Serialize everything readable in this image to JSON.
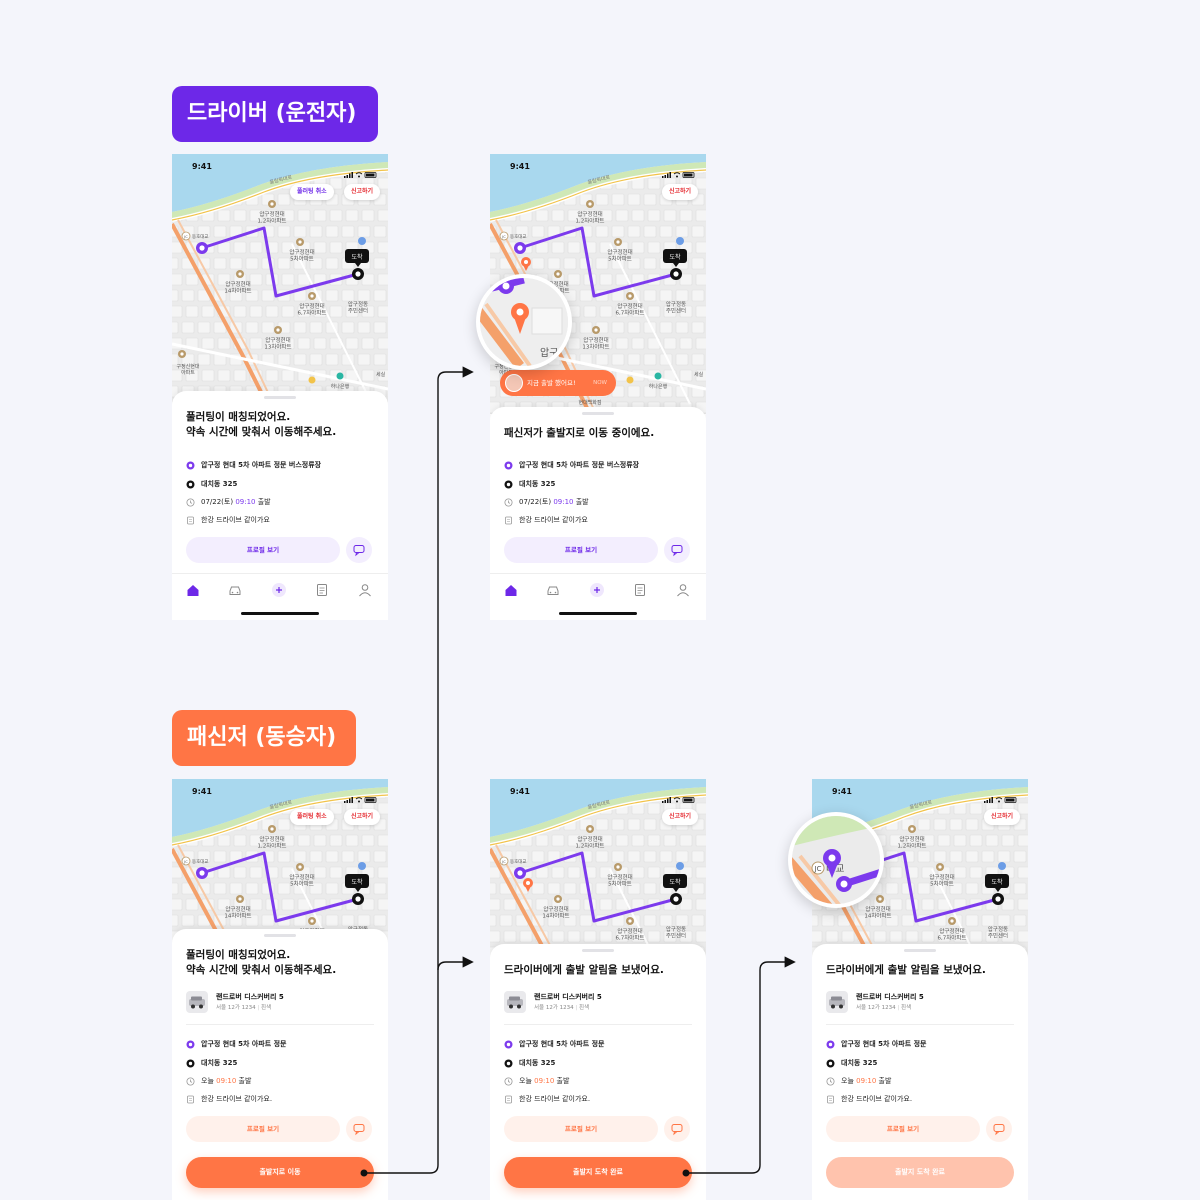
{
  "driver_tag": "드라이버 (운전자)",
  "passenger_tag": "패신저 (동승자)",
  "status_time": "9:41",
  "map": {
    "road_label": "올림픽대로",
    "bridge_label": "동호대교",
    "jc_label": "JC",
    "place_1": "압구정현대\n1,2차아파트",
    "place_2": "압구정현대\n5차아파트",
    "place_3": "압구정현대\n14차아파트",
    "place_4": "압구정현대\n6,7차아파트",
    "place_5": "압구정현대\n13차아파트",
    "place_6": "압구정동\n주민센터",
    "place_7": "하나은행",
    "place_8": "구정신현대\n아파트",
    "place_9": "세실",
    "place_10": "현대백화점",
    "arrive_badge": "도착",
    "zoom_label_1": "압구",
    "zoom_label_2": "대교"
  },
  "chips": {
    "cancel": "풀러팅 취소",
    "report": "신고하기"
  },
  "colors": {
    "driver_accent": "#6d28e8",
    "passenger_accent": "#ff7545",
    "report_red": "#e5292f",
    "route_purple": "#7c3aed"
  },
  "screens": {
    "d1": {
      "title": "풀러팅이 매칭되었어요.\n약속 시간에 맞춰서 이동해주세요.",
      "origin": "압구정 현대 5차 아파트 정문 버스정류장",
      "destination": "대치동 325",
      "time_prefix": "07/22(토) ",
      "time_hl": "09:10",
      "time_suffix": " 출발",
      "memo": "한강 드라이브 같이가요",
      "profile_btn": "프로필 보기"
    },
    "d2": {
      "title": "패신저가 출발지로 이동 중이에요.",
      "origin": "압구정 현대 5차 아파트 정문 버스정류장",
      "destination": "대치동 325",
      "time_prefix": "07/22(토) ",
      "time_hl": "09:10",
      "time_suffix": " 출발",
      "memo": "한강 드라이브 같이가요",
      "profile_btn": "프로필 보기",
      "notification": "지금 출발 했어요!",
      "notification_time": "NOW"
    },
    "p1": {
      "title": "풀러팅이 매칭되었어요.\n약속 시간에 맞춰서 이동해주세요.",
      "car_name": "랜드로버 디스커버리 5",
      "car_plate": "서울 12가 1234",
      "car_color": "흰색",
      "origin": "압구정 현대 5차 아파트 정문",
      "destination": "대치동 325",
      "time_prefix": "오늘 ",
      "time_hl": "09:10",
      "time_suffix": " 출발",
      "memo": "한강 드라이브 같이가요.",
      "profile_btn": "프로필 보기",
      "main_btn": "출발지로 이동"
    },
    "p2": {
      "title": "드라이버에게 출발 알림을 보냈어요.",
      "car_name": "랜드로버 디스커버리 5",
      "car_plate": "서울 12가 1234",
      "car_color": "흰색",
      "origin": "압구정 현대 5차 아파트 정문",
      "destination": "대치동 325",
      "time_prefix": "오늘 ",
      "time_hl": "09:10",
      "time_suffix": " 출발",
      "memo": "한강 드라이브 같이가요.",
      "profile_btn": "프로필 보기",
      "main_btn": "출발지 도착 완료"
    },
    "p3": {
      "title": "드라이버에게 출발 알림을 보냈어요.",
      "car_name": "랜드로버 디스커버리 5",
      "car_plate": "서울 12가 1234",
      "car_color": "흰색",
      "origin": "압구정 현대 5차 아파트 정문",
      "destination": "대치동 325",
      "time_prefix": "오늘 ",
      "time_hl": "09:10",
      "time_suffix": " 출발",
      "memo": "한강 드라이브 같이가요.",
      "profile_btn": "프로필 보기",
      "main_btn": "출발지 도착 완료"
    }
  },
  "tabs": [
    "home-icon",
    "car-icon",
    "plus-icon",
    "document-icon",
    "person-icon"
  ]
}
